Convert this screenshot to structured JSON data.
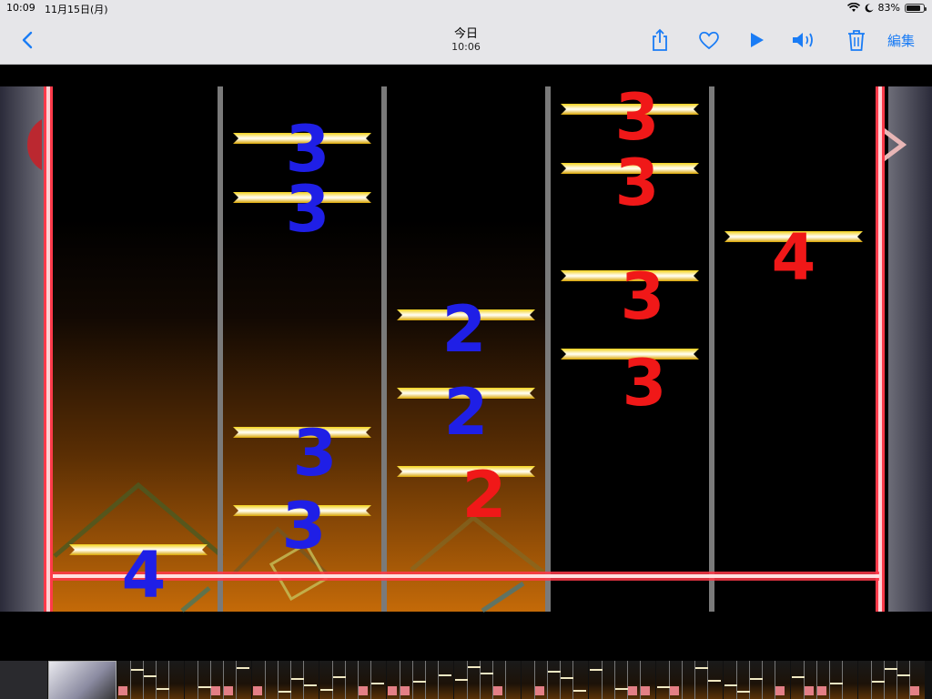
{
  "status_bar": {
    "time": "10:09",
    "date": "11月15日(月)",
    "battery_percent": "83%",
    "battery_level": 0.83,
    "icons": [
      "wifi-icon",
      "moon-icon",
      "battery-icon"
    ]
  },
  "nav_bar": {
    "title": "今日",
    "subtitle": "10:06",
    "edit_label": "編集",
    "buttons": [
      "back-icon",
      "share-icon",
      "heart-icon",
      "play-icon",
      "volume-icon",
      "trash-icon"
    ],
    "accent_color": "#1a7cf5"
  },
  "photo": {
    "annotations": [
      {
        "lane": 1,
        "digit": "4",
        "color": "blue"
      },
      {
        "lane": 2,
        "digit": "3",
        "color": "blue"
      },
      {
        "lane": 2,
        "digit": "3",
        "color": "blue"
      },
      {
        "lane": 2,
        "digit": "3",
        "color": "blue"
      },
      {
        "lane": 2,
        "digit": "3",
        "color": "blue"
      },
      {
        "lane": 3,
        "digit": "2",
        "color": "blue"
      },
      {
        "lane": 3,
        "digit": "2",
        "color": "blue"
      },
      {
        "lane": 3,
        "digit": "2",
        "color": "red"
      },
      {
        "lane": 4,
        "digit": "3",
        "color": "red"
      },
      {
        "lane": 4,
        "digit": "3",
        "color": "red"
      },
      {
        "lane": 4,
        "digit": "3",
        "color": "red"
      },
      {
        "lane": 4,
        "digit": "3",
        "color": "red"
      },
      {
        "lane": 5,
        "digit": "4",
        "color": "red"
      }
    ],
    "colors": {
      "blue_ink": "#1f1fe6",
      "red_ink": "#f01818",
      "note_gold": "#f2c40a",
      "judge_line": "#ff3a4a"
    }
  }
}
